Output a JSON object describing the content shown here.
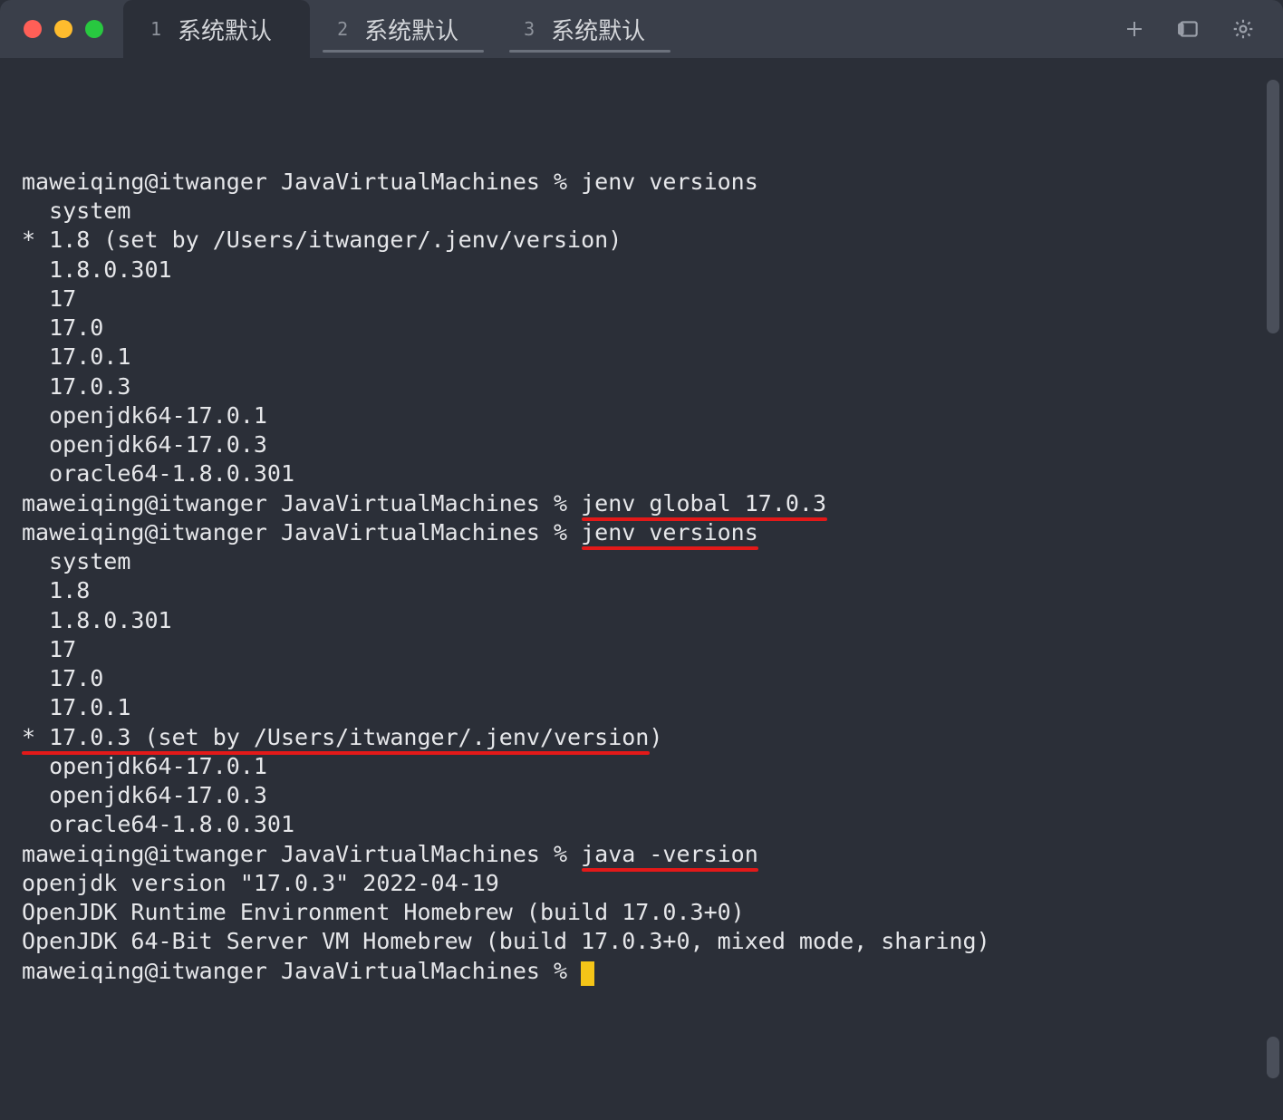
{
  "colors": {
    "bg": "#2b2f38",
    "tabbar": "#3a3f4a",
    "text": "#e6e7ea",
    "muted": "#9ba0aa",
    "underline": "#e31919",
    "cursor": "#f5c518",
    "traffic_red": "#ff5f57",
    "traffic_yellow": "#febc2e",
    "traffic_green": "#28c840"
  },
  "tabs": [
    {
      "num": "1",
      "label": "系统默认",
      "active": true
    },
    {
      "num": "2",
      "label": "系统默认",
      "active": false
    },
    {
      "num": "3",
      "label": "系统默认",
      "active": false
    }
  ],
  "title_icons": {
    "new_tab": "plus-icon",
    "panels": "panels-icon",
    "settings": "gear-icon"
  },
  "prompt": "maweiqing@itwanger JavaVirtualMachines % ",
  "lines": [
    "maweiqing@itwanger JavaVirtualMachines % jenv versions",
    "  system",
    "* 1.8 (set by /Users/itwanger/.jenv/version)",
    "  1.8.0.301",
    "  17",
    "  17.0",
    "  17.0.1",
    "  17.0.3",
    "  openjdk64-17.0.1",
    "  openjdk64-17.0.3",
    "  oracle64-1.8.0.301",
    "maweiqing@itwanger JavaVirtualMachines % jenv global 17.0.3",
    "maweiqing@itwanger JavaVirtualMachines % jenv versions",
    "  system",
    "  1.8",
    "  1.8.0.301",
    "  17",
    "  17.0",
    "  17.0.1",
    "* 17.0.3 (set by /Users/itwanger/.jenv/version)",
    "  openjdk64-17.0.1",
    "  openjdk64-17.0.3",
    "  oracle64-1.8.0.301",
    "maweiqing@itwanger JavaVirtualMachines % java -version",
    "openjdk version \"17.0.3\" 2022-04-19",
    "OpenJDK Runtime Environment Homebrew (build 17.0.3+0)",
    "OpenJDK 64-Bit Server VM Homebrew (build 17.0.3+0, mixed mode, sharing)",
    "maweiqing@itwanger JavaVirtualMachines % "
  ],
  "underlines": [
    {
      "line": 11,
      "left_ch": 41,
      "width_ch": 18
    },
    {
      "line": 12,
      "left_ch": 41,
      "width_ch": 13
    },
    {
      "line": 19,
      "left_ch": 0,
      "width_ch": 46
    },
    {
      "line": 23,
      "left_ch": 41,
      "width_ch": 13
    }
  ]
}
